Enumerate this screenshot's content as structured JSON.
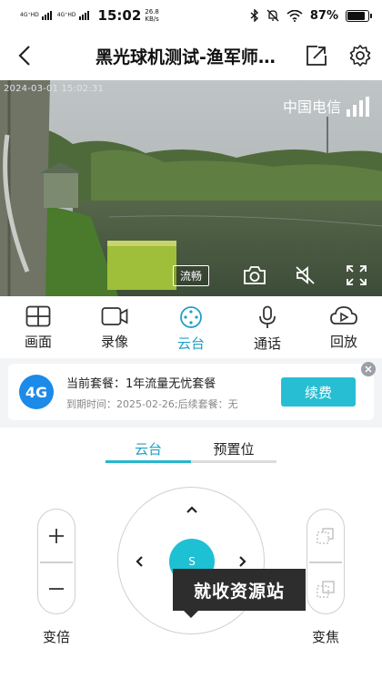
{
  "status_bar": {
    "sim1_tag": "4G⁺HD",
    "sim2_tag": "4G⁺HD",
    "time": "15:02",
    "speed_value": "26.8",
    "speed_unit": "KB/s",
    "battery": "87%",
    "battery_level": 0.87,
    "icons": [
      "bluetooth-icon",
      "mute-icon",
      "wifi-icon",
      "battery-icon"
    ]
  },
  "header": {
    "title": "黑光球机测试-渔军师…",
    "icons": [
      "back-arrow-icon",
      "share-icon",
      "gear-icon"
    ]
  },
  "video": {
    "timestamp": "2024-03-01 15:02:31",
    "carrier": "中国电信",
    "quality_label": "流畅",
    "icons": [
      "camera-icon",
      "speaker-mute-icon",
      "fullscreen-icon"
    ]
  },
  "functions": [
    {
      "label": "画面",
      "icon": "grid-icon"
    },
    {
      "label": "录像",
      "icon": "video-camera-icon"
    },
    {
      "label": "云台",
      "icon": "ptz-icon"
    },
    {
      "label": "通话",
      "icon": "microphone-icon"
    },
    {
      "label": "回放",
      "icon": "playback-icon"
    }
  ],
  "package": {
    "badge": "4G",
    "line1": "当前套餐：1年流量无忧套餐",
    "line2": "到期时间：2025-02-26;后续套餐：无",
    "renew_label": "续费"
  },
  "tabs": [
    {
      "label": "云台",
      "active": true
    },
    {
      "label": "预置位",
      "active": false
    }
  ],
  "ptz": {
    "zoom_label": "变倍",
    "focus_label": "变焦",
    "center_label": "S"
  },
  "watermark": "就收资源站",
  "colors": {
    "accent": "#1ec0d3",
    "active_text": "#1f9fc6",
    "badge_blue": "#1c8ae8"
  }
}
